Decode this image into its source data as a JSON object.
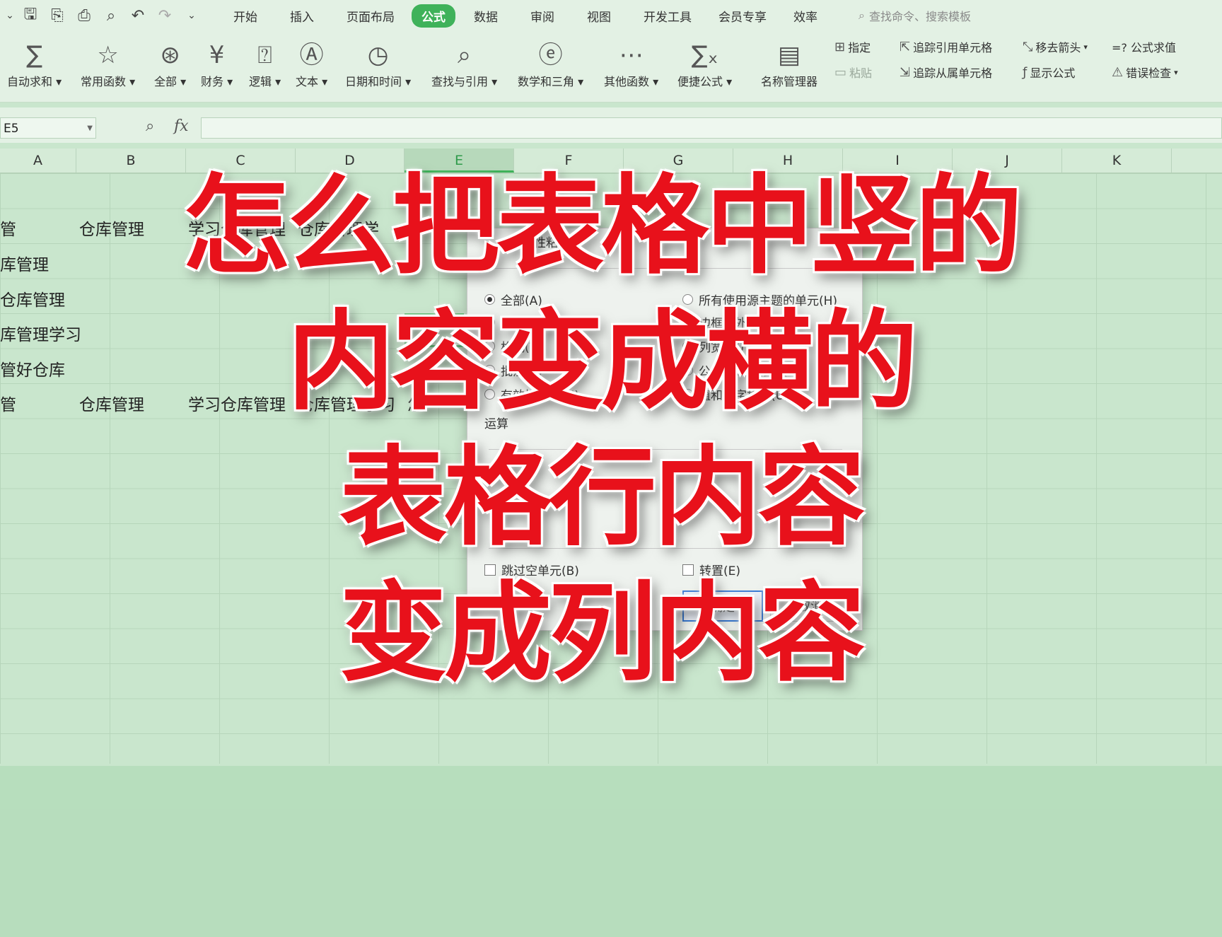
{
  "menubar": {
    "tabs": [
      "开始",
      "插入",
      "页面布局",
      "公式",
      "数据",
      "审阅",
      "视图",
      "开发工具",
      "会员专享",
      "效率"
    ],
    "active_tab": "公式",
    "search_placeholder": "查找命令、搜索模板"
  },
  "ribbon": {
    "large_buttons": [
      {
        "label": "自动求和",
        "icon": "sum-icon"
      },
      {
        "label": "常用函数",
        "icon": "star-icon"
      },
      {
        "label": "全部",
        "icon": "asterisk-icon"
      },
      {
        "label": "财务",
        "icon": "yen-icon"
      },
      {
        "label": "逻辑",
        "icon": "question-icon"
      },
      {
        "label": "文本",
        "icon": "text-icon"
      },
      {
        "label": "日期和时间",
        "icon": "clock-icon"
      },
      {
        "label": "查找与引用",
        "icon": "search-icon"
      },
      {
        "label": "数学和三角",
        "icon": "theta-icon"
      },
      {
        "label": "其他函数",
        "icon": "more-icon"
      },
      {
        "label": "便捷公式",
        "icon": "formula-icon"
      },
      {
        "label": "名称管理器",
        "icon": "name-manager-icon"
      }
    ],
    "small_buttons": {
      "assign": "指定",
      "paste": "粘贴",
      "trace_precedents": "追踪引用单元格",
      "trace_dependents": "追踪从属单元格",
      "remove_arrows": "移去箭头",
      "show_formulas": "显示公式",
      "evaluate": "=? 公式求值",
      "error_check": "错误检查"
    }
  },
  "formula_bar": {
    "name_box": "E5",
    "fx": "fx",
    "value": ""
  },
  "columns": [
    "A",
    "B",
    "C",
    "D",
    "E",
    "F",
    "G",
    "H",
    "I",
    "J",
    "K"
  ],
  "selected_column": "E",
  "cells": {
    "r2": [
      "管",
      "仓库管理",
      "学习仓库管理",
      "仓库管理学"
    ],
    "r3": "库管理",
    "r4": "仓库管理",
    "r5": "库管理学习",
    "r6": "管好仓库",
    "r7": [
      "管",
      "仓库管理",
      "学习仓库管理",
      "仓库管理学习",
      "怎"
    ]
  },
  "dialog": {
    "title": "选择性粘贴",
    "options_left": [
      "全部(A)",
      "数值(V)",
      "格式(T)",
      "批注(C)",
      "有效性验证(N)"
    ],
    "options_right": [
      "所有使用源主题的单元(H)",
      "边框除外(X)",
      "列宽(W)",
      "公式和数字格式(R)",
      "值和数字格式(U)"
    ],
    "section_operation": "运算",
    "skip_blanks": "跳过空单元(B)",
    "transpose": "转置(E)",
    "ok": "确定",
    "cancel": "取消"
  },
  "caption": {
    "line1": "怎么把表格中竖的",
    "line2": "内容变成横的",
    "line3": "表格行内容",
    "line4": "变成列内容"
  },
  "colors": {
    "accent": "#3fb25a",
    "caption": "#e8111b",
    "background": "#c9e6cd"
  }
}
